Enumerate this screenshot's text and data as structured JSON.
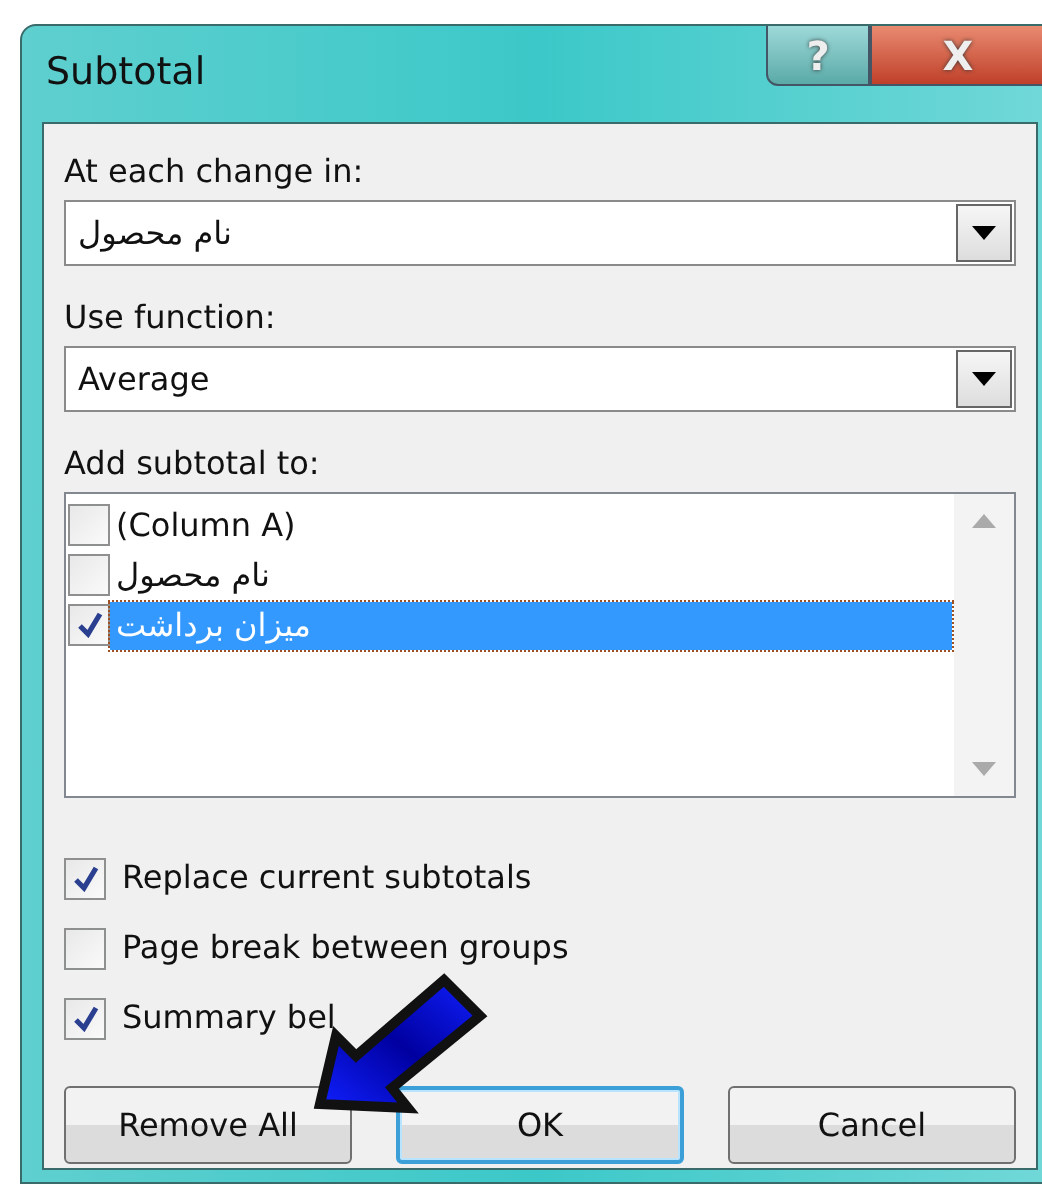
{
  "window": {
    "title": "Subtotal",
    "buttons": [
      "?",
      "X"
    ]
  },
  "at_each_change": {
    "label": "At each change in:",
    "value": "نام محصول"
  },
  "use_function": {
    "label": "Use function:",
    "value": "Average"
  },
  "add_subtotal": {
    "label": "Add subtotal to:",
    "items": [
      {
        "label": "(Column A)",
        "checked": false,
        "selected": false
      },
      {
        "label": "نام محصول",
        "checked": false,
        "selected": false
      },
      {
        "label": "میزان برداشت",
        "checked": true,
        "selected": true
      }
    ]
  },
  "options": [
    {
      "label": "Replace current subtotals",
      "checked": true
    },
    {
      "label": "Page break between groups",
      "checked": false
    },
    {
      "label": "Summary bel",
      "checked": true
    }
  ],
  "buttons": [
    {
      "label": "Remove All",
      "default": false
    },
    {
      "label": "OK",
      "default": true
    },
    {
      "label": "Cancel",
      "default": false
    }
  ]
}
